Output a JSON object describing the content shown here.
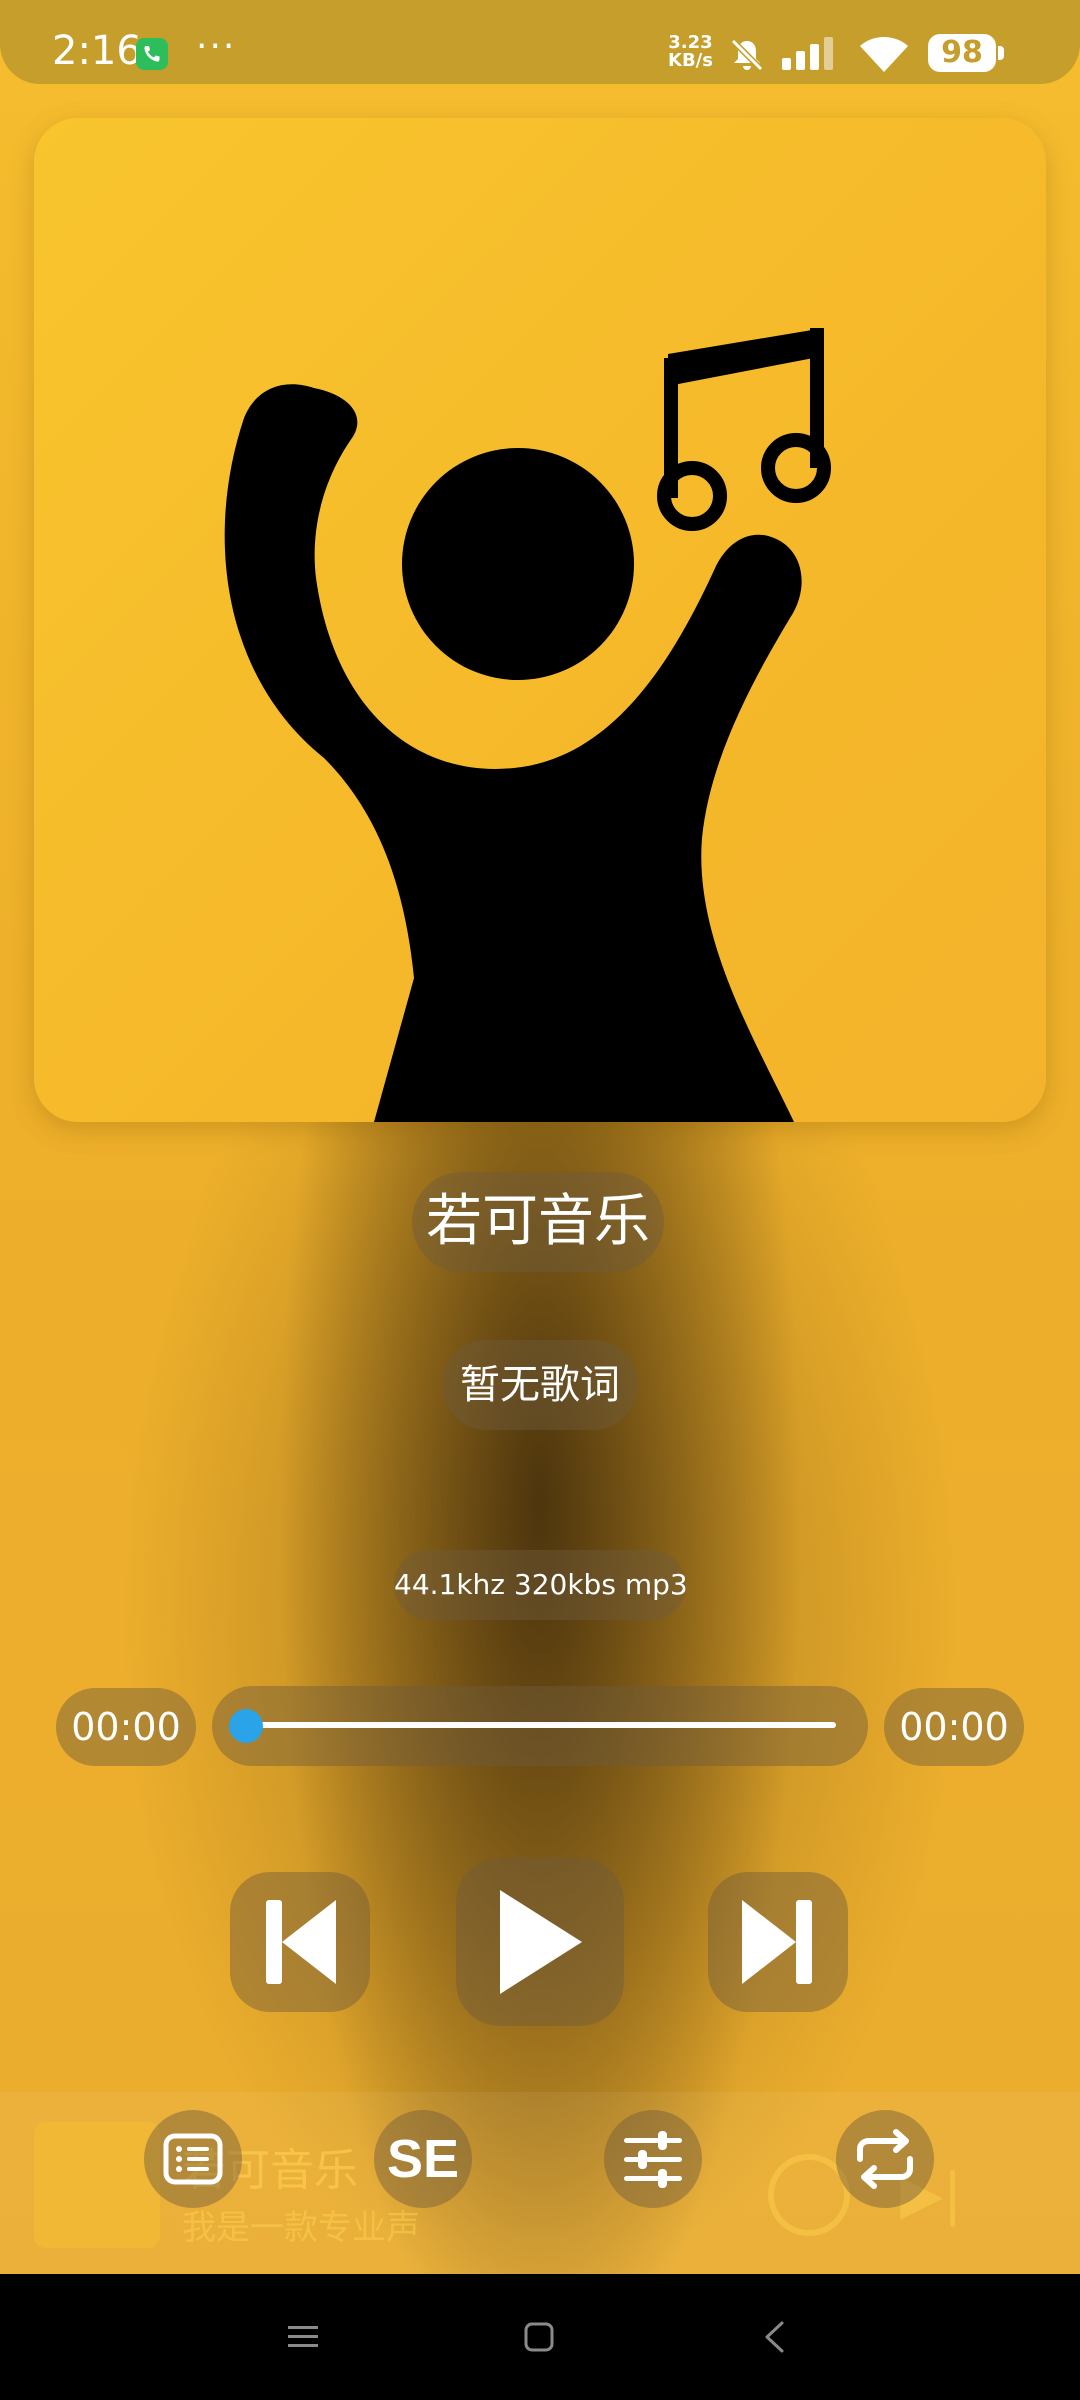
{
  "status_bar": {
    "time": "2:16",
    "more": "···",
    "net_speed_value": "3.23",
    "net_speed_unit": "KB/s",
    "battery": "98"
  },
  "player": {
    "title": "若可音乐",
    "lyrics": "暂无歌词",
    "audio_format": "44.1khz 320kbs mp3",
    "time_current": "00:00",
    "time_total": "00:00",
    "progress": 0.0
  },
  "controls": {
    "se_label": "SE"
  },
  "mini_player": {
    "title": "若可音乐",
    "subtitle": "我是一款专业声"
  },
  "colors": {
    "accent": "#2aa3e8",
    "background": "#f2b52c"
  }
}
